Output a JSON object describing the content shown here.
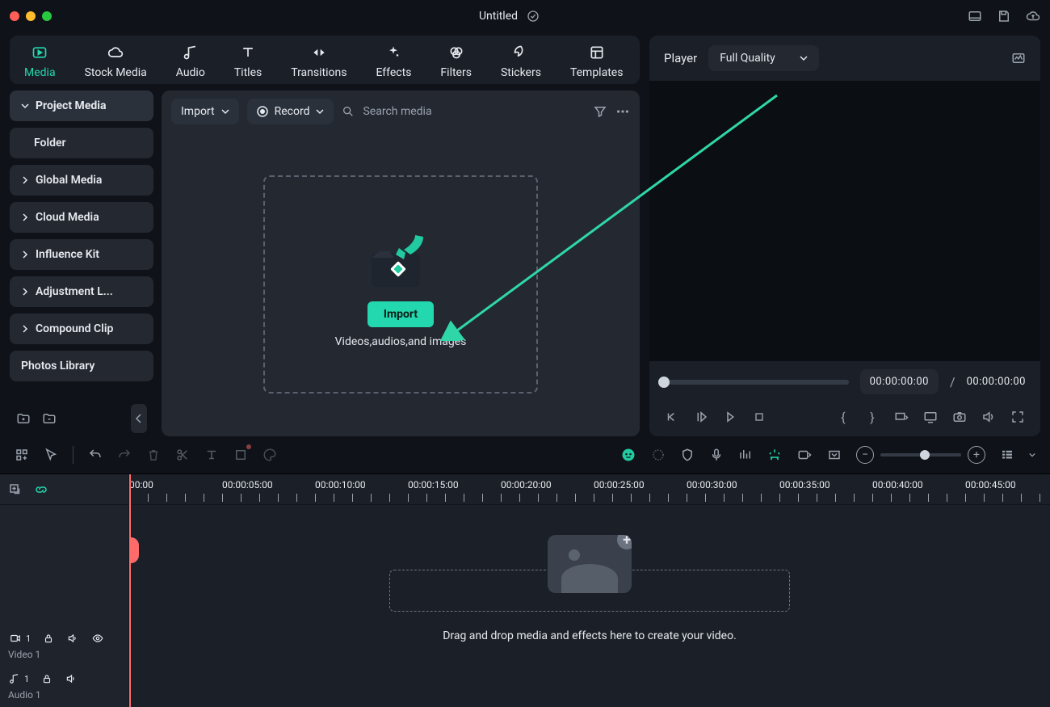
{
  "title": "Untitled",
  "tabs": {
    "media": "Media",
    "stock": "Stock Media",
    "audio": "Audio",
    "titles": "Titles",
    "transitions": "Transitions",
    "effects": "Effects",
    "filters": "Filters",
    "stickers": "Stickers",
    "templates": "Templates"
  },
  "sidebar": {
    "project": "Project Media",
    "folder": "Folder",
    "global": "Global Media",
    "cloud": "Cloud Media",
    "influence": "Influence Kit",
    "adjustment": "Adjustment L...",
    "compound": "Compound Clip",
    "photos": "Photos Library"
  },
  "mediaPanel": {
    "importBtn": "Import",
    "recordBtn": "Record",
    "searchPlaceholder": "Search media",
    "dropImport": "Import",
    "dropHint": "Videos,audios,and images"
  },
  "player": {
    "label": "Player",
    "quality": "Full Quality",
    "time_current": "00:00:00:00",
    "time_sep": "/",
    "time_total": "00:00:00:00"
  },
  "timeline": {
    "ticks": [
      "00:00",
      "00:00:05:00",
      "00:00:10:00",
      "00:00:15:00",
      "00:00:20:00",
      "00:00:25:00",
      "00:00:30:00",
      "00:00:35:00",
      "00:00:40:00",
      "00:00:45:00"
    ],
    "video_idx": "1",
    "video_label": "Video 1",
    "audio_idx": "1",
    "audio_label": "Audio 1",
    "dropHint": "Drag and drop media and effects here to create your video."
  }
}
